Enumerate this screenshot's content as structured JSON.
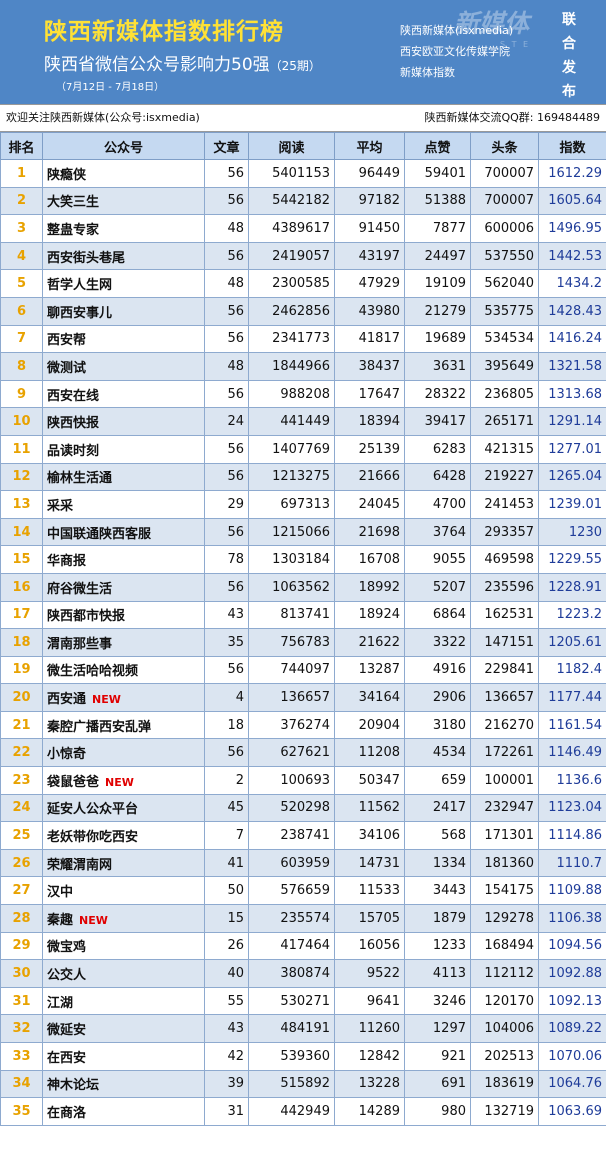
{
  "header": {
    "title": "陕西新媒体指数排行榜",
    "subtitle": "陕西省微信公众号影响力50强",
    "issue": "（25期）",
    "date_range": "（7月12日 - 7月18日）",
    "publishers": [
      "陕西新媒体(isxmedia)",
      "西安欧亚文化传媒学院",
      "新媒体指数"
    ],
    "release": "联合发布",
    "watermark": "新媒体",
    "watermark_sub": "S T E"
  },
  "welcome": {
    "left": "欢迎关注陕西新媒体(公众号:isxmedia)",
    "right": "陕西新媒体交流QQ群: 169484489"
  },
  "columns": [
    "排名",
    "公众号",
    "文章",
    "阅读",
    "平均",
    "点赞",
    "头条",
    "指数"
  ],
  "new_label": "NEW",
  "rows": [
    {
      "rank": "1",
      "name": "陕瘾侠",
      "articles": "56",
      "reads": "5401153",
      "avg": "96449",
      "likes": "59401",
      "headline": "700007",
      "index": "1612.29",
      "is_new": false
    },
    {
      "rank": "2",
      "name": "大笑三生",
      "articles": "56",
      "reads": "5442182",
      "avg": "97182",
      "likes": "51388",
      "headline": "700007",
      "index": "1605.64",
      "is_new": false
    },
    {
      "rank": "3",
      "name": "整蛊专家",
      "articles": "48",
      "reads": "4389617",
      "avg": "91450",
      "likes": "7877",
      "headline": "600006",
      "index": "1496.95",
      "is_new": false
    },
    {
      "rank": "4",
      "name": "西安街头巷尾",
      "articles": "56",
      "reads": "2419057",
      "avg": "43197",
      "likes": "24497",
      "headline": "537550",
      "index": "1442.53",
      "is_new": false
    },
    {
      "rank": "5",
      "name": "哲学人生网",
      "articles": "48",
      "reads": "2300585",
      "avg": "47929",
      "likes": "19109",
      "headline": "562040",
      "index": "1434.2",
      "is_new": false
    },
    {
      "rank": "6",
      "name": "聊西安事儿",
      "articles": "56",
      "reads": "2462856",
      "avg": "43980",
      "likes": "21279",
      "headline": "535775",
      "index": "1428.43",
      "is_new": false
    },
    {
      "rank": "7",
      "name": "西安帮",
      "articles": "56",
      "reads": "2341773",
      "avg": "41817",
      "likes": "19689",
      "headline": "534534",
      "index": "1416.24",
      "is_new": false
    },
    {
      "rank": "8",
      "name": "微测试",
      "articles": "48",
      "reads": "1844966",
      "avg": "38437",
      "likes": "3631",
      "headline": "395649",
      "index": "1321.58",
      "is_new": false
    },
    {
      "rank": "9",
      "name": "西安在线",
      "articles": "56",
      "reads": "988208",
      "avg": "17647",
      "likes": "28322",
      "headline": "236805",
      "index": "1313.68",
      "is_new": false
    },
    {
      "rank": "10",
      "name": "陕西快报",
      "articles": "24",
      "reads": "441449",
      "avg": "18394",
      "likes": "39417",
      "headline": "265171",
      "index": "1291.14",
      "is_new": false
    },
    {
      "rank": "11",
      "name": "品读时刻",
      "articles": "56",
      "reads": "1407769",
      "avg": "25139",
      "likes": "6283",
      "headline": "421315",
      "index": "1277.01",
      "is_new": false
    },
    {
      "rank": "12",
      "name": "榆林生活通",
      "articles": "56",
      "reads": "1213275",
      "avg": "21666",
      "likes": "6428",
      "headline": "219227",
      "index": "1265.04",
      "is_new": false
    },
    {
      "rank": "13",
      "name": "采采",
      "articles": "29",
      "reads": "697313",
      "avg": "24045",
      "likes": "4700",
      "headline": "241453",
      "index": "1239.01",
      "is_new": false
    },
    {
      "rank": "14",
      "name": "中国联通陕西客服",
      "articles": "56",
      "reads": "1215066",
      "avg": "21698",
      "likes": "3764",
      "headline": "293357",
      "index": "1230",
      "is_new": false
    },
    {
      "rank": "15",
      "name": "华商报",
      "articles": "78",
      "reads": "1303184",
      "avg": "16708",
      "likes": "9055",
      "headline": "469598",
      "index": "1229.55",
      "is_new": false
    },
    {
      "rank": "16",
      "name": "府谷微生活",
      "articles": "56",
      "reads": "1063562",
      "avg": "18992",
      "likes": "5207",
      "headline": "235596",
      "index": "1228.91",
      "is_new": false
    },
    {
      "rank": "17",
      "name": "陕西都市快报",
      "articles": "43",
      "reads": "813741",
      "avg": "18924",
      "likes": "6864",
      "headline": "162531",
      "index": "1223.2",
      "is_new": false
    },
    {
      "rank": "18",
      "name": "渭南那些事",
      "articles": "35",
      "reads": "756783",
      "avg": "21622",
      "likes": "3322",
      "headline": "147151",
      "index": "1205.61",
      "is_new": false
    },
    {
      "rank": "19",
      "name": "微生活哈哈视频",
      "articles": "56",
      "reads": "744097",
      "avg": "13287",
      "likes": "4916",
      "headline": "229841",
      "index": "1182.4",
      "is_new": false
    },
    {
      "rank": "20",
      "name": "西安通",
      "articles": "4",
      "reads": "136657",
      "avg": "34164",
      "likes": "2906",
      "headline": "136657",
      "index": "1177.44",
      "is_new": true
    },
    {
      "rank": "21",
      "name": "秦腔广播西安乱弹",
      "articles": "18",
      "reads": "376274",
      "avg": "20904",
      "likes": "3180",
      "headline": "216270",
      "index": "1161.54",
      "is_new": false
    },
    {
      "rank": "22",
      "name": "小惊奇",
      "articles": "56",
      "reads": "627621",
      "avg": "11208",
      "likes": "4534",
      "headline": "172261",
      "index": "1146.49",
      "is_new": false
    },
    {
      "rank": "23",
      "name": "袋鼠爸爸",
      "articles": "2",
      "reads": "100693",
      "avg": "50347",
      "likes": "659",
      "headline": "100001",
      "index": "1136.6",
      "is_new": true
    },
    {
      "rank": "24",
      "name": "延安人公众平台",
      "articles": "45",
      "reads": "520298",
      "avg": "11562",
      "likes": "2417",
      "headline": "232947",
      "index": "1123.04",
      "is_new": false
    },
    {
      "rank": "25",
      "name": "老妖带你吃西安",
      "articles": "7",
      "reads": "238741",
      "avg": "34106",
      "likes": "568",
      "headline": "171301",
      "index": "1114.86",
      "is_new": false
    },
    {
      "rank": "26",
      "name": "荣耀渭南网",
      "articles": "41",
      "reads": "603959",
      "avg": "14731",
      "likes": "1334",
      "headline": "181360",
      "index": "1110.7",
      "is_new": false
    },
    {
      "rank": "27",
      "name": "汉中",
      "articles": "50",
      "reads": "576659",
      "avg": "11533",
      "likes": "3443",
      "headline": "154175",
      "index": "1109.88",
      "is_new": false
    },
    {
      "rank": "28",
      "name": "秦趣",
      "articles": "15",
      "reads": "235574",
      "avg": "15705",
      "likes": "1879",
      "headline": "129278",
      "index": "1106.38",
      "is_new": true
    },
    {
      "rank": "29",
      "name": "微宝鸡",
      "articles": "26",
      "reads": "417464",
      "avg": "16056",
      "likes": "1233",
      "headline": "168494",
      "index": "1094.56",
      "is_new": false
    },
    {
      "rank": "30",
      "name": "公交人",
      "articles": "40",
      "reads": "380874",
      "avg": "9522",
      "likes": "4113",
      "headline": "112112",
      "index": "1092.88",
      "is_new": false
    },
    {
      "rank": "31",
      "name": "江湖",
      "articles": "55",
      "reads": "530271",
      "avg": "9641",
      "likes": "3246",
      "headline": "120170",
      "index": "1092.13",
      "is_new": false
    },
    {
      "rank": "32",
      "name": "微延安",
      "articles": "43",
      "reads": "484191",
      "avg": "11260",
      "likes": "1297",
      "headline": "104006",
      "index": "1089.22",
      "is_new": false
    },
    {
      "rank": "33",
      "name": "在西安",
      "articles": "42",
      "reads": "539360",
      "avg": "12842",
      "likes": "921",
      "headline": "202513",
      "index": "1070.06",
      "is_new": false
    },
    {
      "rank": "34",
      "name": "神木论坛",
      "articles": "39",
      "reads": "515892",
      "avg": "13228",
      "likes": "691",
      "headline": "183619",
      "index": "1064.76",
      "is_new": false
    },
    {
      "rank": "35",
      "name": "在商洛",
      "articles": "31",
      "reads": "442949",
      "avg": "14289",
      "likes": "980",
      "headline": "132719",
      "index": "1063.69",
      "is_new": false
    }
  ]
}
